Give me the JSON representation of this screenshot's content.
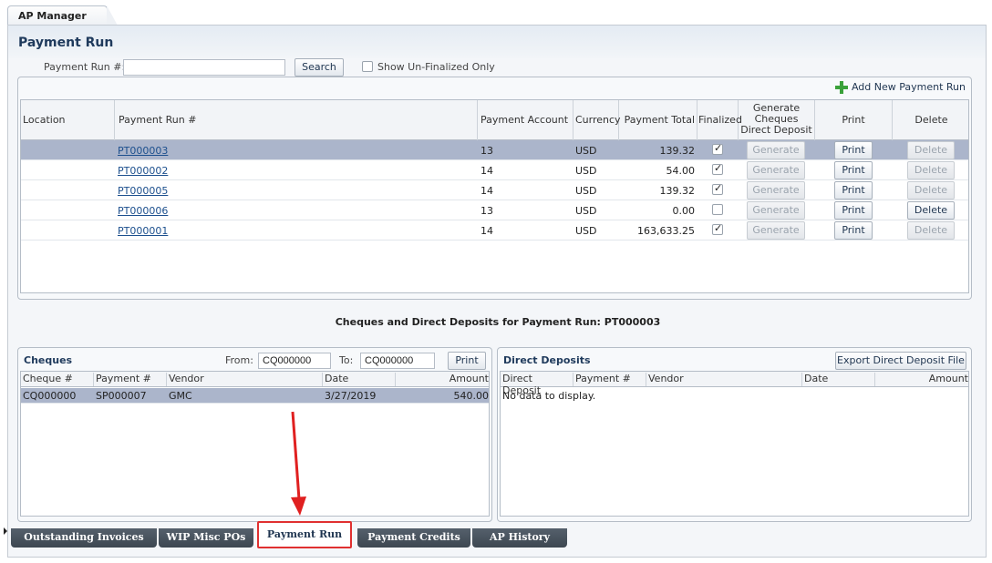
{
  "app_tab": "AP Manager",
  "page_title": "Payment Run",
  "search": {
    "label": "Payment Run #:",
    "value": "",
    "button": "Search",
    "show_unfinalized_label": "Show Un-Finalized Only",
    "show_unfinalized": false
  },
  "add_new_label": "Add New Payment Run",
  "runs_table": {
    "headers": [
      "Location",
      "Payment Run #",
      "Payment Account",
      "Currency",
      "Payment Total",
      "Finalized",
      "Generate Cheques Direct Deposit",
      "Print",
      "Delete"
    ],
    "rows": [
      {
        "location": "",
        "run": "PT000003",
        "account": "13",
        "currency": "USD",
        "total": "139.32",
        "finalized": true,
        "generate": "Generate",
        "print": "Print",
        "delete": "Delete",
        "delete_enabled": false,
        "selected": true
      },
      {
        "location": "",
        "run": "PT000002",
        "account": "14",
        "currency": "USD",
        "total": "54.00",
        "finalized": true,
        "generate": "Generate",
        "print": "Print",
        "delete": "Delete",
        "delete_enabled": false,
        "selected": false
      },
      {
        "location": "",
        "run": "PT000005",
        "account": "14",
        "currency": "USD",
        "total": "139.32",
        "finalized": true,
        "generate": "Generate",
        "print": "Print",
        "delete": "Delete",
        "delete_enabled": false,
        "selected": false
      },
      {
        "location": "",
        "run": "PT000006",
        "account": "13",
        "currency": "USD",
        "total": "0.00",
        "finalized": false,
        "generate": "Generate",
        "print": "Print",
        "delete": "Delete",
        "delete_enabled": true,
        "selected": false
      },
      {
        "location": "",
        "run": "PT000001",
        "account": "14",
        "currency": "USD",
        "total": "163,633.25",
        "finalized": true,
        "generate": "Generate",
        "print": "Print",
        "delete": "Delete",
        "delete_enabled": false,
        "selected": false
      }
    ]
  },
  "details_title": "Cheques and Direct Deposits for Payment Run: PT000003",
  "cheques": {
    "title": "Cheques",
    "from_label": "From:",
    "from_value": "CQ000000",
    "to_label": "To:",
    "to_value": "CQ000000",
    "print": "Print",
    "headers": [
      "Cheque #",
      "Payment #",
      "Vendor",
      "Date",
      "Amount"
    ],
    "rows": [
      {
        "cheque": "CQ000000",
        "payment": "SP000007",
        "vendor": "GMC",
        "date": "3/27/2019",
        "amount": "540.00"
      }
    ]
  },
  "direct_deposits": {
    "title": "Direct Deposits",
    "export": "Export Direct Deposit File",
    "headers": [
      "Direct Deposit",
      "Payment #",
      "Vendor",
      "Date",
      "Amount"
    ],
    "empty": "No data to display."
  },
  "bottom_tabs": [
    "Outstanding Invoices",
    "WIP Misc POs",
    "Payment Run",
    "Payment Credits",
    "AP History"
  ],
  "active_tab": "Payment Run",
  "colors": {
    "selected_row": "#abb5cb",
    "title": "#1f3a5c",
    "highlight": "#e03030",
    "arrow": "#e02020"
  }
}
